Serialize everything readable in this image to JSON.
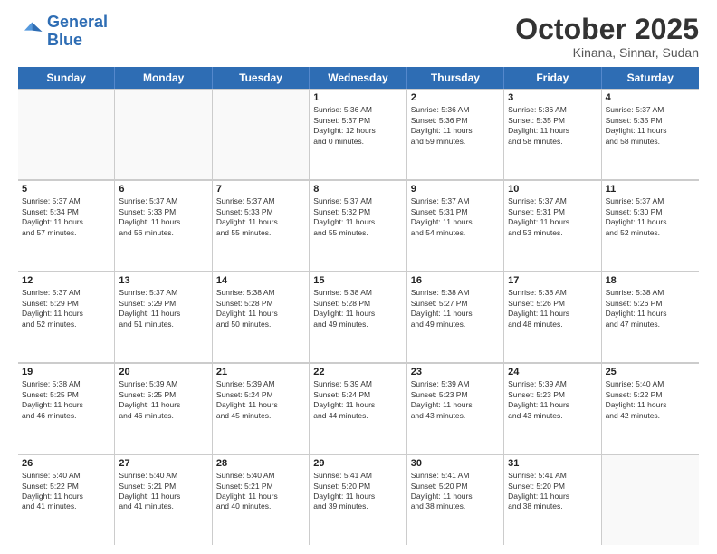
{
  "logo": {
    "line1": "General",
    "line2": "Blue"
  },
  "title": "October 2025",
  "location": "Kinana, Sinnar, Sudan",
  "header_days": [
    "Sunday",
    "Monday",
    "Tuesday",
    "Wednesday",
    "Thursday",
    "Friday",
    "Saturday"
  ],
  "weeks": [
    [
      {
        "day": "",
        "info": ""
      },
      {
        "day": "",
        "info": ""
      },
      {
        "day": "",
        "info": ""
      },
      {
        "day": "1",
        "info": "Sunrise: 5:36 AM\nSunset: 5:37 PM\nDaylight: 12 hours\nand 0 minutes."
      },
      {
        "day": "2",
        "info": "Sunrise: 5:36 AM\nSunset: 5:36 PM\nDaylight: 11 hours\nand 59 minutes."
      },
      {
        "day": "3",
        "info": "Sunrise: 5:36 AM\nSunset: 5:35 PM\nDaylight: 11 hours\nand 58 minutes."
      },
      {
        "day": "4",
        "info": "Sunrise: 5:37 AM\nSunset: 5:35 PM\nDaylight: 11 hours\nand 58 minutes."
      }
    ],
    [
      {
        "day": "5",
        "info": "Sunrise: 5:37 AM\nSunset: 5:34 PM\nDaylight: 11 hours\nand 57 minutes."
      },
      {
        "day": "6",
        "info": "Sunrise: 5:37 AM\nSunset: 5:33 PM\nDaylight: 11 hours\nand 56 minutes."
      },
      {
        "day": "7",
        "info": "Sunrise: 5:37 AM\nSunset: 5:33 PM\nDaylight: 11 hours\nand 55 minutes."
      },
      {
        "day": "8",
        "info": "Sunrise: 5:37 AM\nSunset: 5:32 PM\nDaylight: 11 hours\nand 55 minutes."
      },
      {
        "day": "9",
        "info": "Sunrise: 5:37 AM\nSunset: 5:31 PM\nDaylight: 11 hours\nand 54 minutes."
      },
      {
        "day": "10",
        "info": "Sunrise: 5:37 AM\nSunset: 5:31 PM\nDaylight: 11 hours\nand 53 minutes."
      },
      {
        "day": "11",
        "info": "Sunrise: 5:37 AM\nSunset: 5:30 PM\nDaylight: 11 hours\nand 52 minutes."
      }
    ],
    [
      {
        "day": "12",
        "info": "Sunrise: 5:37 AM\nSunset: 5:29 PM\nDaylight: 11 hours\nand 52 minutes."
      },
      {
        "day": "13",
        "info": "Sunrise: 5:37 AM\nSunset: 5:29 PM\nDaylight: 11 hours\nand 51 minutes."
      },
      {
        "day": "14",
        "info": "Sunrise: 5:38 AM\nSunset: 5:28 PM\nDaylight: 11 hours\nand 50 minutes."
      },
      {
        "day": "15",
        "info": "Sunrise: 5:38 AM\nSunset: 5:28 PM\nDaylight: 11 hours\nand 49 minutes."
      },
      {
        "day": "16",
        "info": "Sunrise: 5:38 AM\nSunset: 5:27 PM\nDaylight: 11 hours\nand 49 minutes."
      },
      {
        "day": "17",
        "info": "Sunrise: 5:38 AM\nSunset: 5:26 PM\nDaylight: 11 hours\nand 48 minutes."
      },
      {
        "day": "18",
        "info": "Sunrise: 5:38 AM\nSunset: 5:26 PM\nDaylight: 11 hours\nand 47 minutes."
      }
    ],
    [
      {
        "day": "19",
        "info": "Sunrise: 5:38 AM\nSunset: 5:25 PM\nDaylight: 11 hours\nand 46 minutes."
      },
      {
        "day": "20",
        "info": "Sunrise: 5:39 AM\nSunset: 5:25 PM\nDaylight: 11 hours\nand 46 minutes."
      },
      {
        "day": "21",
        "info": "Sunrise: 5:39 AM\nSunset: 5:24 PM\nDaylight: 11 hours\nand 45 minutes."
      },
      {
        "day": "22",
        "info": "Sunrise: 5:39 AM\nSunset: 5:24 PM\nDaylight: 11 hours\nand 44 minutes."
      },
      {
        "day": "23",
        "info": "Sunrise: 5:39 AM\nSunset: 5:23 PM\nDaylight: 11 hours\nand 43 minutes."
      },
      {
        "day": "24",
        "info": "Sunrise: 5:39 AM\nSunset: 5:23 PM\nDaylight: 11 hours\nand 43 minutes."
      },
      {
        "day": "25",
        "info": "Sunrise: 5:40 AM\nSunset: 5:22 PM\nDaylight: 11 hours\nand 42 minutes."
      }
    ],
    [
      {
        "day": "26",
        "info": "Sunrise: 5:40 AM\nSunset: 5:22 PM\nDaylight: 11 hours\nand 41 minutes."
      },
      {
        "day": "27",
        "info": "Sunrise: 5:40 AM\nSunset: 5:21 PM\nDaylight: 11 hours\nand 41 minutes."
      },
      {
        "day": "28",
        "info": "Sunrise: 5:40 AM\nSunset: 5:21 PM\nDaylight: 11 hours\nand 40 minutes."
      },
      {
        "day": "29",
        "info": "Sunrise: 5:41 AM\nSunset: 5:20 PM\nDaylight: 11 hours\nand 39 minutes."
      },
      {
        "day": "30",
        "info": "Sunrise: 5:41 AM\nSunset: 5:20 PM\nDaylight: 11 hours\nand 38 minutes."
      },
      {
        "day": "31",
        "info": "Sunrise: 5:41 AM\nSunset: 5:20 PM\nDaylight: 11 hours\nand 38 minutes."
      },
      {
        "day": "",
        "info": ""
      }
    ]
  ]
}
